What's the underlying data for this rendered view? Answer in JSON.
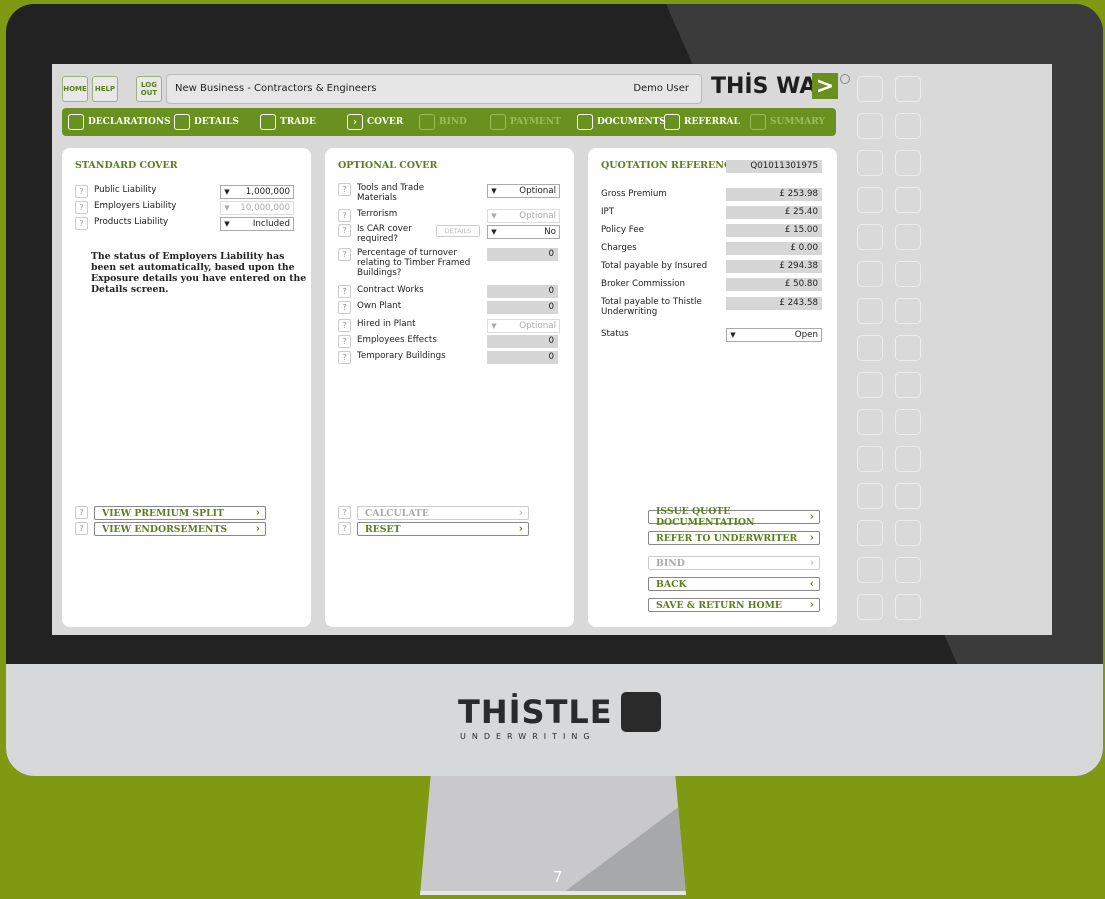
{
  "topbar": {
    "home": "HOME",
    "help": "HELP",
    "logout": "LOG OUT",
    "title": "New Business - Contractors & Engineers",
    "user": "Demo User",
    "logo_text": "THİS WAY",
    "logo_arrow": ">"
  },
  "nav": [
    {
      "label": "DECLARATIONS",
      "state": "unchecked"
    },
    {
      "label": "DETAILS",
      "state": "unchecked"
    },
    {
      "label": "TRADE",
      "state": "unchecked"
    },
    {
      "label": "COVER",
      "state": "current"
    },
    {
      "label": "BIND",
      "state": "disabled"
    },
    {
      "label": "PAYMENT",
      "state": "disabled"
    },
    {
      "label": "DOCUMENTS",
      "state": "unchecked"
    },
    {
      "label": "REFERRAL",
      "state": "unchecked"
    },
    {
      "label": "SUMMARY",
      "state": "disabled"
    }
  ],
  "standard_cover": {
    "title": "STANDARD COVER",
    "items": [
      {
        "label": "Public Liability",
        "value": "1,000,000"
      },
      {
        "label": "Employers Liability",
        "value": "10,000,000"
      },
      {
        "label": "Products Liability",
        "value": "Included"
      }
    ],
    "message": "The status of Employers Liability has been set automatically, based upon the Exposure details you have entered on the Details screen.",
    "buttons": {
      "premium_split": "VIEW PREMIUM SPLIT",
      "endorsements": "VIEW ENDORSEMENTS"
    }
  },
  "optional_cover": {
    "title": "OPTIONAL COVER",
    "items": [
      {
        "label": "Tools and Trade Materials",
        "value": "Optional"
      },
      {
        "label": "Terrorism",
        "value": "Optional"
      },
      {
        "label": "Is CAR cover required?",
        "value": "No"
      },
      {
        "label": "Percentage of turnover relating to Timber Framed Buildings?",
        "value": "0"
      },
      {
        "label": "Contract Works",
        "value": "0"
      },
      {
        "label": "Own Plant",
        "value": "0"
      },
      {
        "label": "Hired in Plant",
        "value": "Optional"
      },
      {
        "label": "Employees Effects",
        "value": "0"
      },
      {
        "label": "Temporary Buildings",
        "value": "0"
      }
    ],
    "details_label": "DETAILS",
    "buttons": {
      "calculate": "CALCULATE",
      "reset": "RESET"
    }
  },
  "quotation": {
    "title": "QUOTATION REFERENCE",
    "reference": "Q01011301975",
    "rows": [
      {
        "label": "Gross Premium",
        "value": "£ 253.98"
      },
      {
        "label": "IPT",
        "value": "£ 25.40"
      },
      {
        "label": "Policy Fee",
        "value": "£ 15.00"
      },
      {
        "label": "Charges",
        "value": "£ 0.00"
      },
      {
        "label": "Total payable by Insured",
        "value": "£ 294.38"
      },
      {
        "label": "Broker Commission",
        "value": "£ 50.80"
      },
      {
        "label": "Total payable to Thistle Underwriting",
        "value": "£ 243.58"
      }
    ],
    "status_label": "Status",
    "status_value": "Open",
    "buttons": {
      "issue": "ISSUE QUOTE DOCUMENTATION",
      "refer": "REFER TO UNDERWRITER",
      "bind": "BIND",
      "back": "BACK",
      "save": "SAVE & RETURN HOME"
    }
  },
  "monitor": {
    "brand": "THİSTLE",
    "brand_sub": "UNDERWRITING",
    "page_number": "7"
  },
  "colors": {
    "accent": "#68911f",
    "background": "#7f9a12"
  }
}
